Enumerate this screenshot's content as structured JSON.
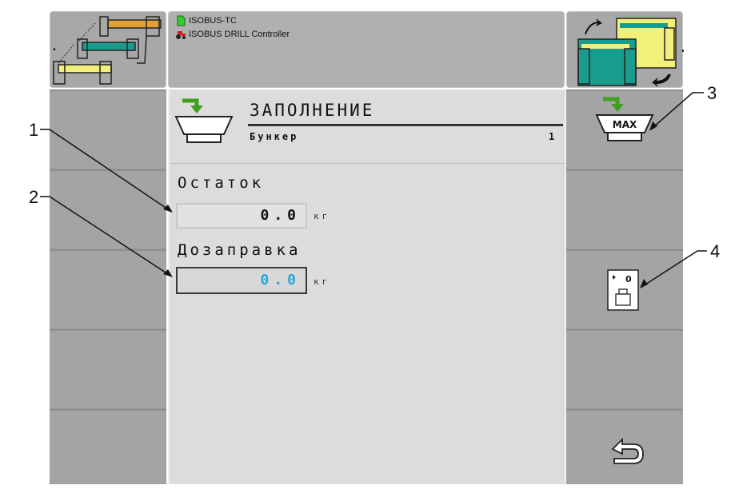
{
  "header": {
    "source_line_1": "ISOBUS-TC",
    "source_line_2": "ISOBUS DRILL Controller"
  },
  "page": {
    "title": "ЗАПОЛНЕНИЕ",
    "subtitle": "Бункер",
    "subtitle_index": "1"
  },
  "fields": {
    "remaining_label": "Остаток",
    "remaining_value": "0.0",
    "remaining_unit": "кг",
    "refill_label": "Дозаправка",
    "refill_value": "0.0",
    "refill_unit": "кг"
  },
  "softkeys": {
    "max_label": "MAX",
    "tare_label": "0"
  },
  "callouts": [
    "1",
    "2",
    "3",
    "4"
  ],
  "colors": {
    "teal": "#1a9c8c",
    "yellow": "#f2f07a",
    "green_arrow": "#3fa020",
    "value_blue": "#2aa6e0"
  }
}
